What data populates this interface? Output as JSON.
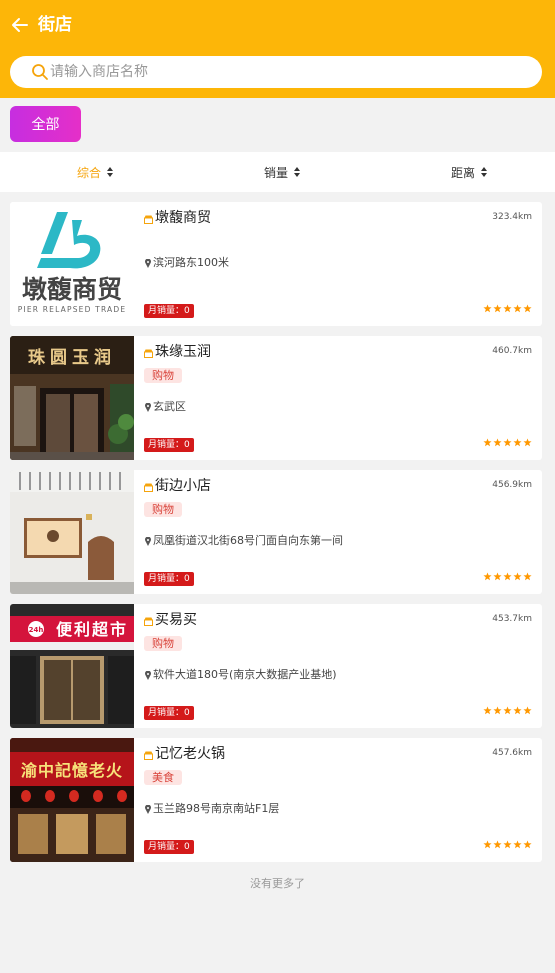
{
  "header": {
    "title": "街店"
  },
  "search": {
    "placeholder": "请输入商店名称"
  },
  "category_chip": {
    "label": "全部"
  },
  "sort_tabs": [
    {
      "label": "综合",
      "active": true
    },
    {
      "label": "销量",
      "active": false
    },
    {
      "label": "距离",
      "active": false
    }
  ],
  "stores": [
    {
      "name": "墩馥商贸",
      "distance": "323.4km",
      "tag": "",
      "address": "滨河路东100米",
      "sales": "月销量：0",
      "rating": 5,
      "logo_title": "墩馥商贸",
      "logo_sub": "PIER RELAPSED TRADE"
    },
    {
      "name": "珠缘玉润",
      "distance": "460.7km",
      "tag": "购物",
      "address": "玄武区",
      "sales": "月销量：0",
      "rating": 5,
      "sign_text": "珠圆玉润"
    },
    {
      "name": "街边小店",
      "distance": "456.9km",
      "tag": "购物",
      "address": "凤凰街道汉北街68号门面自向东第一间",
      "sales": "月销量：0",
      "rating": 5
    },
    {
      "name": "买易买",
      "distance": "453.7km",
      "tag": "购物",
      "address": "软件大道180号(南京大数据产业基地)",
      "sales": "月销量：0",
      "rating": 5,
      "sign_text": "便利超市",
      "sign_badge": "24h"
    },
    {
      "name": "记忆老火锅",
      "distance": "457.6km",
      "tag": "美食",
      "address": "玉兰路98号南京南站F1层",
      "sales": "月销量：0",
      "rating": 5,
      "sign_text": "渝中記憶老火"
    }
  ],
  "footer": {
    "text": "没有更多了"
  },
  "colors": {
    "header_bg": "#fdb608",
    "accent": "#f5a40c",
    "sales_badge": "#d41a1a",
    "chip_gradient_start": "#c62ee0",
    "chip_gradient_end": "#e52fc8",
    "star": "#ff9800"
  }
}
